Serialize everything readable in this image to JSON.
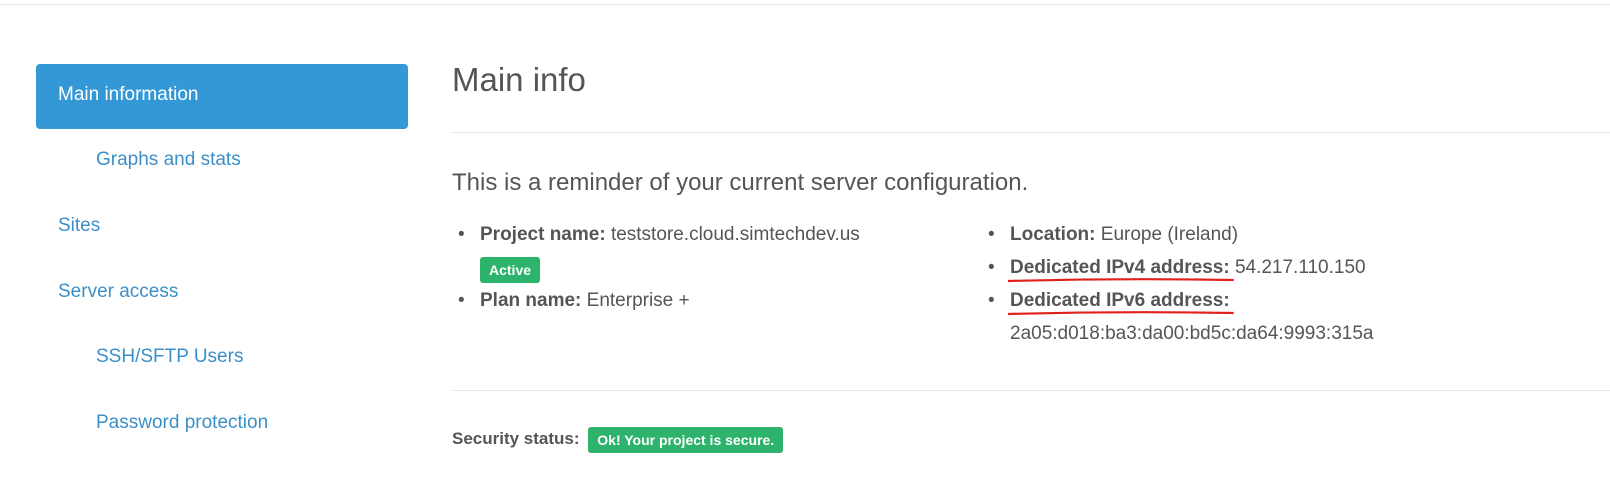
{
  "sidebar": {
    "items": [
      {
        "label": "Main information"
      },
      {
        "label": "Graphs and stats"
      },
      {
        "label": "Sites"
      },
      {
        "label": "Server access"
      },
      {
        "label": "SSH/SFTP Users"
      },
      {
        "label": "Password protection"
      }
    ]
  },
  "main": {
    "title": "Main info",
    "reminder": "This is a reminder of your current server configuration.",
    "project": {
      "name_label": "Project name:",
      "name_value": "teststore.cloud.simtechdev.us",
      "status_badge": "Active",
      "plan_label": "Plan name:",
      "plan_value": "Enterprise +"
    },
    "server": {
      "location_label": "Location:",
      "location_value": "Europe (Ireland)",
      "ipv4_label": "Dedicated IPv4 address:",
      "ipv4_value": "54.217.110.150",
      "ipv6_label": "Dedicated IPv6 address:",
      "ipv6_value": "2a05:d018:ba3:da00:bd5c:da64:9993:315a"
    },
    "security": {
      "label": "Security status:",
      "badge": "Ok! Your project is secure."
    }
  },
  "colors": {
    "accent": "#3498d6",
    "link": "#3b8fc8",
    "success": "#2db36c",
    "annotation": "#e0201a"
  }
}
